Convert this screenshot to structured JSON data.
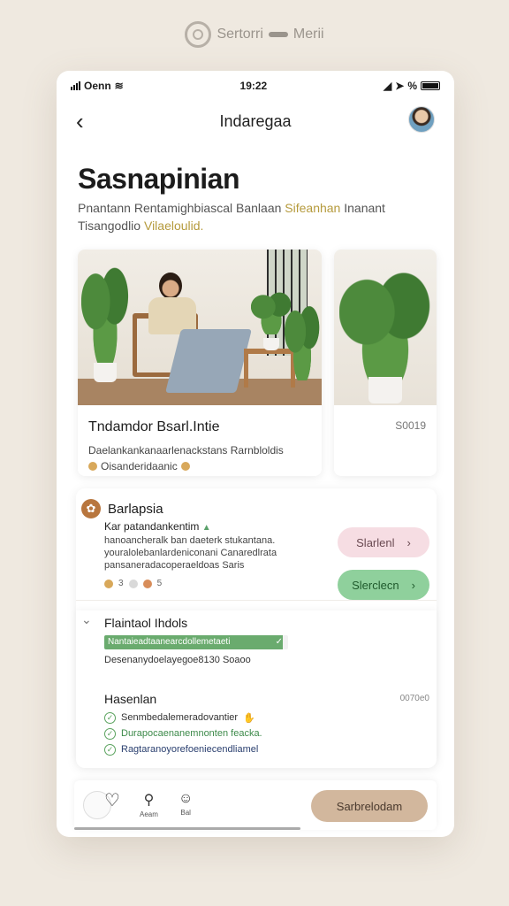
{
  "brand": {
    "name": "Sertorri",
    "suffix": "Merii"
  },
  "status": {
    "carrier": "Oenn",
    "time": "19:22",
    "battery": "%"
  },
  "nav": {
    "title": "Indaregaa"
  },
  "hero": {
    "title": "Sasnapinian",
    "subtitle_main": "Pnantann Rentamighbiascal Banlaan",
    "subtitle_accent": "Sifeanhan",
    "subtitle_end": "Inanant",
    "subtitle_line2": "Tisangodlio",
    "subtitle_line2_accent": "Vilaeloulid."
  },
  "cards": [
    {
      "title": "Tndamdor Bsarl.Intie",
      "desc": "Daelankankanaarlenackstans Rarnbloldis",
      "meta": "Oisanderidaanic"
    },
    {
      "code": "S0019"
    }
  ],
  "panel": {
    "title": "Barlapsia",
    "lead": "Kar patandankentim",
    "lines": [
      "hanoancheralk ban daeterk stukantana.",
      "youralolebanlardeniconani Canaredlrata",
      "pansaneradacoperaeldoas Saris"
    ],
    "tags": [
      "3",
      "5"
    ],
    "btn_pink": "Slarlenl",
    "btn_green": "Slerclecn",
    "section2": {
      "title": "Flaintaol Ihdols",
      "progress_label": "Nantaieadtaanearcdollemetaeti",
      "progress_value": 0.97,
      "progress_caption": "Desenanydoelayegoe8130 Soaoo"
    },
    "list": {
      "title": "Hasenlan",
      "meta": "0070e0",
      "items": [
        "Senmbedalemeradovantier",
        "Durapocaenanemnonten feacka.",
        "Ragtaranoyorefoeniecendliamel"
      ]
    }
  },
  "bottom": {
    "search_label": "Aeam",
    "chat_label": "Bal",
    "cta": "Sarbrelodam"
  },
  "colors": {
    "accent_green": "#8fd09c",
    "accent_pink": "#f6dde3",
    "cta_tan": "#d2b79d",
    "icon_brown": "#b8763e"
  }
}
